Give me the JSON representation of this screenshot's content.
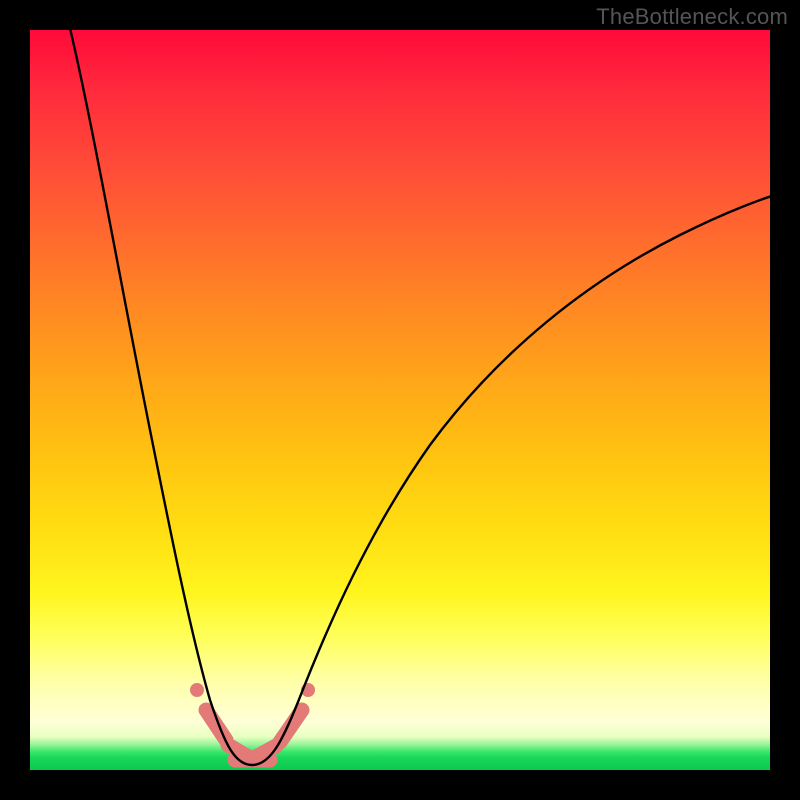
{
  "watermark": "TheBottleneck.com",
  "colors": {
    "frame_bg": "#000000",
    "watermark_text": "#555555",
    "curve_color": "#000000",
    "marker_color": "#e47a78",
    "gradient_stops": [
      {
        "pos": 0,
        "color": "#ff0a3a"
      },
      {
        "pos": 0.08,
        "color": "#ff2a3c"
      },
      {
        "pos": 0.18,
        "color": "#ff4a38"
      },
      {
        "pos": 0.28,
        "color": "#ff6a2e"
      },
      {
        "pos": 0.38,
        "color": "#ff8a22"
      },
      {
        "pos": 0.48,
        "color": "#ffa818"
      },
      {
        "pos": 0.58,
        "color": "#ffc410"
      },
      {
        "pos": 0.68,
        "color": "#ffdf12"
      },
      {
        "pos": 0.76,
        "color": "#fff51e"
      },
      {
        "pos": 0.82,
        "color": "#ffff5a"
      },
      {
        "pos": 0.88,
        "color": "#ffffa8"
      },
      {
        "pos": 0.935,
        "color": "#ffffd8"
      },
      {
        "pos": 0.955,
        "color": "#e8ffc0"
      },
      {
        "pos": 0.965,
        "color": "#9cf59c"
      },
      {
        "pos": 0.975,
        "color": "#3be86a"
      },
      {
        "pos": 0.983,
        "color": "#18d85a"
      },
      {
        "pos": 1.0,
        "color": "#0ec850"
      }
    ]
  },
  "chart_data": {
    "type": "line",
    "title": "",
    "xlabel": "",
    "ylabel": "",
    "x_range": [
      0,
      100
    ],
    "y_range": [
      0,
      100
    ],
    "description": "Bottleneck curve (percentage mismatch) reaching minimum near x≈29 where y≈0; rises steeply to left (y→100 at x≈5) and more gently to right (y≈75 at x=100). Color gradient encodes severity: green≈0, yellow mid, red≈100.",
    "series": [
      {
        "name": "bottleneck-curve",
        "points": [
          {
            "x": 5,
            "y": 100
          },
          {
            "x": 8,
            "y": 88
          },
          {
            "x": 12,
            "y": 70
          },
          {
            "x": 16,
            "y": 50
          },
          {
            "x": 20,
            "y": 30
          },
          {
            "x": 23,
            "y": 15
          },
          {
            "x": 25,
            "y": 7
          },
          {
            "x": 27,
            "y": 2
          },
          {
            "x": 29,
            "y": 0
          },
          {
            "x": 31,
            "y": 0
          },
          {
            "x": 33,
            "y": 2
          },
          {
            "x": 36,
            "y": 8
          },
          {
            "x": 40,
            "y": 17
          },
          {
            "x": 48,
            "y": 32
          },
          {
            "x": 58,
            "y": 45
          },
          {
            "x": 70,
            "y": 57
          },
          {
            "x": 82,
            "y": 66
          },
          {
            "x": 92,
            "y": 72
          },
          {
            "x": 100,
            "y": 75
          }
        ]
      }
    ],
    "markers": {
      "name": "highlighted-range",
      "style": "thick-salmon-capsules",
      "points_x": [
        22.5,
        24.5,
        27,
        30,
        33,
        35.5,
        37.5
      ],
      "segments_x": [
        [
          23.5,
          26
        ],
        [
          26.5,
          29.5
        ],
        [
          30,
          33
        ],
        [
          33.5,
          36.5
        ]
      ]
    }
  }
}
